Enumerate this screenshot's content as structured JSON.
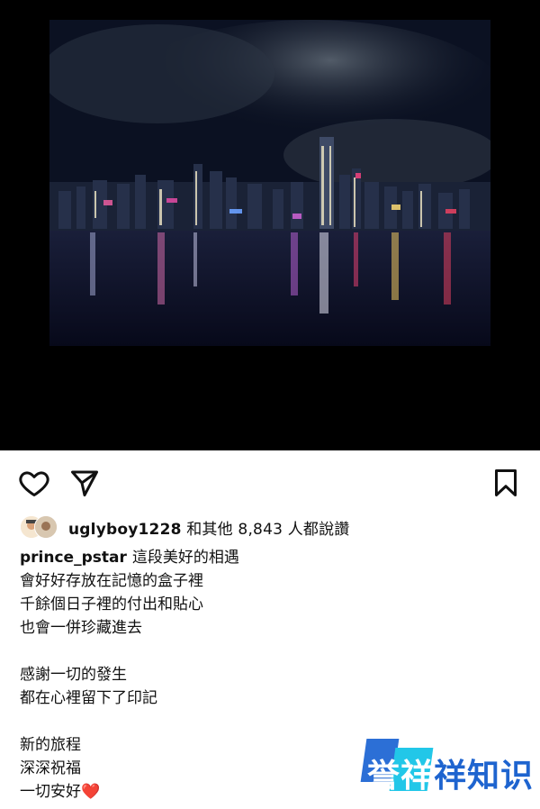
{
  "post": {
    "photo_alt": "night city skyline over harbor"
  },
  "actions": {
    "like_icon": "heart-outline-icon",
    "share_icon": "paper-plane-icon",
    "save_icon": "bookmark-icon"
  },
  "likes": {
    "user": "uglyboy1228",
    "rest": " 和其他 8,843 人都說讚"
  },
  "caption": {
    "username": "prince_pstar",
    "lines": [
      "這段美好的相遇",
      "會好好存放在記憶的盒子裡",
      "千餘個日子裡的付出和貼心",
      "也會一併珍藏進去",
      "",
      "感謝一切的發生",
      "都在心裡留下了印記",
      "",
      "新的旅程",
      "深深祝福",
      "一切安好"
    ],
    "heart_emoji": "❤️"
  },
  "watermark": {
    "char1": "誉",
    "char2": "祥",
    "rest": "祥知识"
  },
  "colors": {
    "watermark_blue": "#1e64cf",
    "watermark_cyan": "#22c7e8",
    "heart_red": "#d6232e"
  }
}
